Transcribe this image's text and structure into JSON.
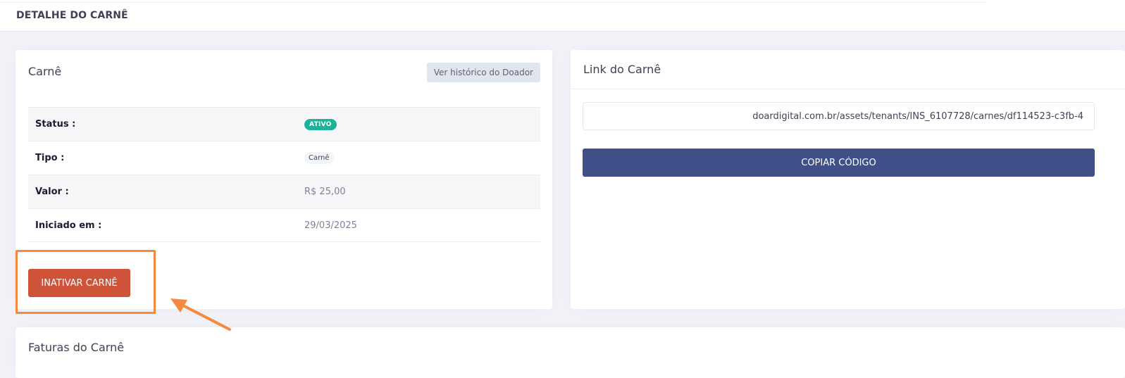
{
  "header": {
    "title": "DETALHE DO CARNÊ"
  },
  "carne_card": {
    "title": "Carnê",
    "history_button": "Ver histórico do Doador",
    "rows": [
      {
        "label": "Status :",
        "value": "ATIVO"
      },
      {
        "label": "Tipo :",
        "value": "Carnê"
      },
      {
        "label": "Valor :",
        "value": "R$ 25,00"
      },
      {
        "label": "Iniciado em :",
        "value": "29/03/2025"
      }
    ],
    "inactivate_button": "INATIVAR CARNÊ"
  },
  "link_card": {
    "title": "Link do Carnê",
    "link_value": "doardigital.com.br/assets/tenants/INS_6107728/carnes/df114523-c3fb-4",
    "copy_button": "COPIAR CÓDIGO"
  },
  "faturas_card": {
    "title": "Faturas do Carnê"
  },
  "colors": {
    "status_badge": "#1bb39a",
    "inactivate_button": "#cf5338",
    "copy_button": "#3f5089",
    "highlight": "#f7893f"
  }
}
